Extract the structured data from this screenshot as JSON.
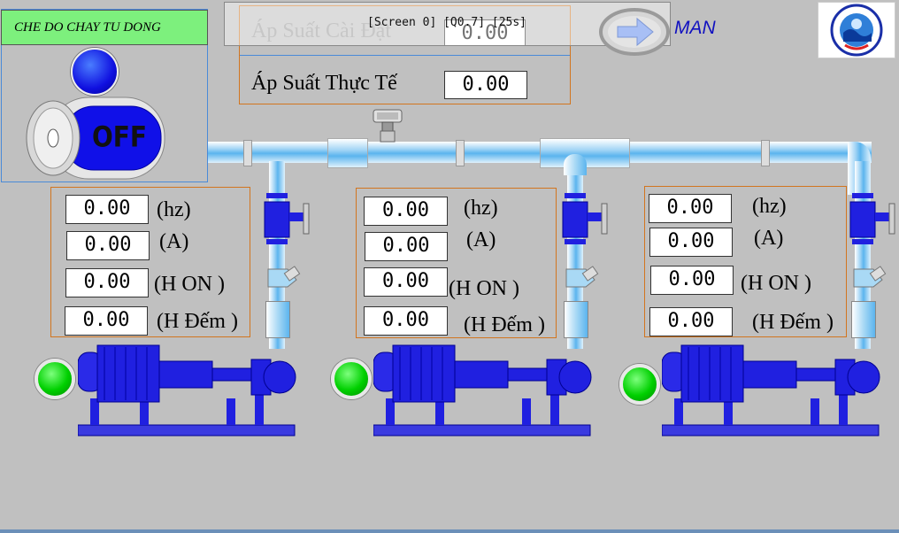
{
  "mode_panel": {
    "title": "CHE DO CHAY TU DONG",
    "switch_label": "OFF"
  },
  "screen_info": "[Screen 0] [Q0.7] [25s]",
  "pressure": {
    "setpoint_label": "Áp Suất Cài Đặt",
    "setpoint_value": "0.00",
    "actual_label": "Áp Suất Thực Tế",
    "actual_value": "0.00"
  },
  "mode_button": {
    "label": "MAN"
  },
  "pumps": [
    {
      "hz": "0.00",
      "amp": "0.00",
      "h_on": "0.00",
      "h_count": "0.00",
      "hz_unit": "(hz)",
      "amp_unit": "(A)",
      "h_on_unit": "(H ON )",
      "h_count_unit": "(H Đếm )"
    },
    {
      "hz": "0.00",
      "amp": "0.00",
      "h_on": "0.00",
      "h_count": "0.00",
      "hz_unit": "(hz)",
      "amp_unit": "(A)",
      "h_on_unit": "(H ON )",
      "h_count_unit": "(H Đếm )"
    },
    {
      "hz": "0.00",
      "amp": "0.00",
      "h_on": "0.00",
      "h_count": "0.00",
      "hz_unit": "(hz)",
      "amp_unit": "(A)",
      "h_on_unit": "(H ON )",
      "h_count_unit": "(H Đếm )"
    }
  ],
  "colors": {
    "background": "#c0c0c0",
    "pump_blue": "#2020e0",
    "status_on": "#00d000",
    "panel_border": "#d2751f",
    "accent": "#1010c0"
  }
}
